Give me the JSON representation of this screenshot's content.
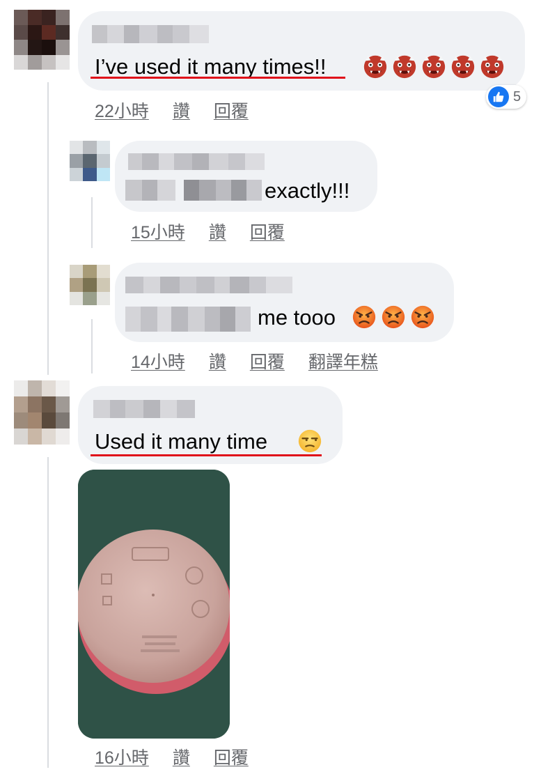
{
  "comments": [
    {
      "text": "I’ve used it many times!!",
      "time": "22小時",
      "like_label": "讚",
      "reply_label": "回覆",
      "reaction_count": "5",
      "emoji": [
        "ogre",
        "ogre",
        "ogre",
        "ogre",
        "ogre"
      ]
    },
    {
      "text": "exactly!!!",
      "time": "15小時",
      "like_label": "讚",
      "reply_label": "回覆"
    },
    {
      "text": "me tooo",
      "time": "14小時",
      "like_label": "讚",
      "reply_label": "回覆",
      "translate_label": "翻譯年糕",
      "emoji": [
        "pouting-face",
        "pouting-face",
        "pouting-face"
      ]
    },
    {
      "text": "Used it many time",
      "time": "16小時",
      "like_label": "讚",
      "reply_label": "回覆",
      "emoji": [
        "unamused-face"
      ],
      "has_photo": true
    }
  ],
  "colors": {
    "bubble": "#f0f2f5",
    "meta_text": "#65676b",
    "highlight_underline": "#e0101a",
    "like_blue": "#1877f2"
  }
}
